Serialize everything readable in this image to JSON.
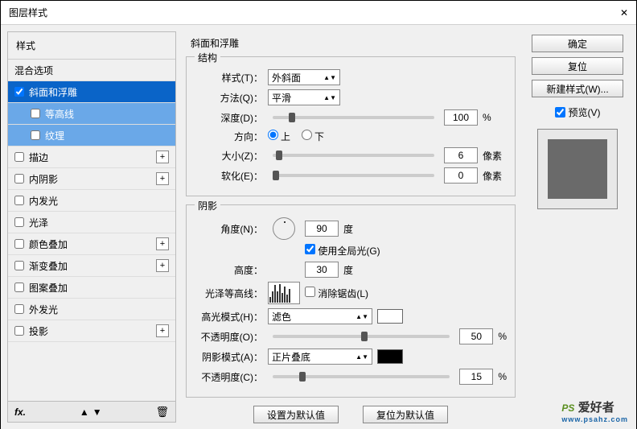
{
  "window": {
    "title": "图层样式",
    "close": "✕"
  },
  "left": {
    "header": "样式",
    "blend": "混合选项",
    "items": [
      {
        "label": "斜面和浮雕",
        "checked": true,
        "selected": true,
        "plus": false
      },
      {
        "label": "等高线",
        "checked": false,
        "sub": true
      },
      {
        "label": "纹理",
        "checked": false,
        "sub": true
      },
      {
        "label": "描边",
        "checked": false,
        "plus": true
      },
      {
        "label": "内阴影",
        "checked": false,
        "plus": true
      },
      {
        "label": "内发光",
        "checked": false,
        "plus": false
      },
      {
        "label": "光泽",
        "checked": false,
        "plus": false
      },
      {
        "label": "颜色叠加",
        "checked": false,
        "plus": true
      },
      {
        "label": "渐变叠加",
        "checked": false,
        "plus": true
      },
      {
        "label": "图案叠加",
        "checked": false,
        "plus": false
      },
      {
        "label": "外发光",
        "checked": false,
        "plus": false
      },
      {
        "label": "投影",
        "checked": false,
        "plus": true
      }
    ],
    "fx": "fx."
  },
  "panel": {
    "heading": "斜面和浮雕",
    "structure": {
      "title": "结构",
      "style_l": "样式(T)：",
      "style_v": "外斜面",
      "tech_l": "方法(Q)：",
      "tech_v": "平滑",
      "depth_l": "深度(D)：",
      "depth_v": "100",
      "pct": "%",
      "dir_l": "方向：",
      "up": "上",
      "down": "下",
      "size_l": "大小(Z)：",
      "size_v": "6",
      "px": "像素",
      "soft_l": "软化(E)：",
      "soft_v": "0"
    },
    "shading": {
      "title": "阴影",
      "angle_l": "角度(N)：",
      "angle_v": "90",
      "deg": "度",
      "global": "使用全局光(G)",
      "alt_l": "高度：",
      "alt_v": "30",
      "gloss_l": "光泽等高线：",
      "aa": "消除锯齿(L)",
      "hmode_l": "高光模式(H)：",
      "hmode_v": "滤色",
      "hop_l": "不透明度(O)：",
      "hop_v": "50",
      "smode_l": "阴影模式(A)：",
      "smode_v": "正片叠底",
      "sop_l": "不透明度(C)：",
      "sop_v": "15"
    },
    "defaults": {
      "set": "设置为默认值",
      "reset": "复位为默认值"
    }
  },
  "right": {
    "ok": "确定",
    "cancel": "复位",
    "newstyle": "新建样式(W)...",
    "preview": "预览(V)"
  },
  "wm": {
    "ps": "PS",
    "cn": "爱好者",
    "url": "www.psahz.com"
  }
}
